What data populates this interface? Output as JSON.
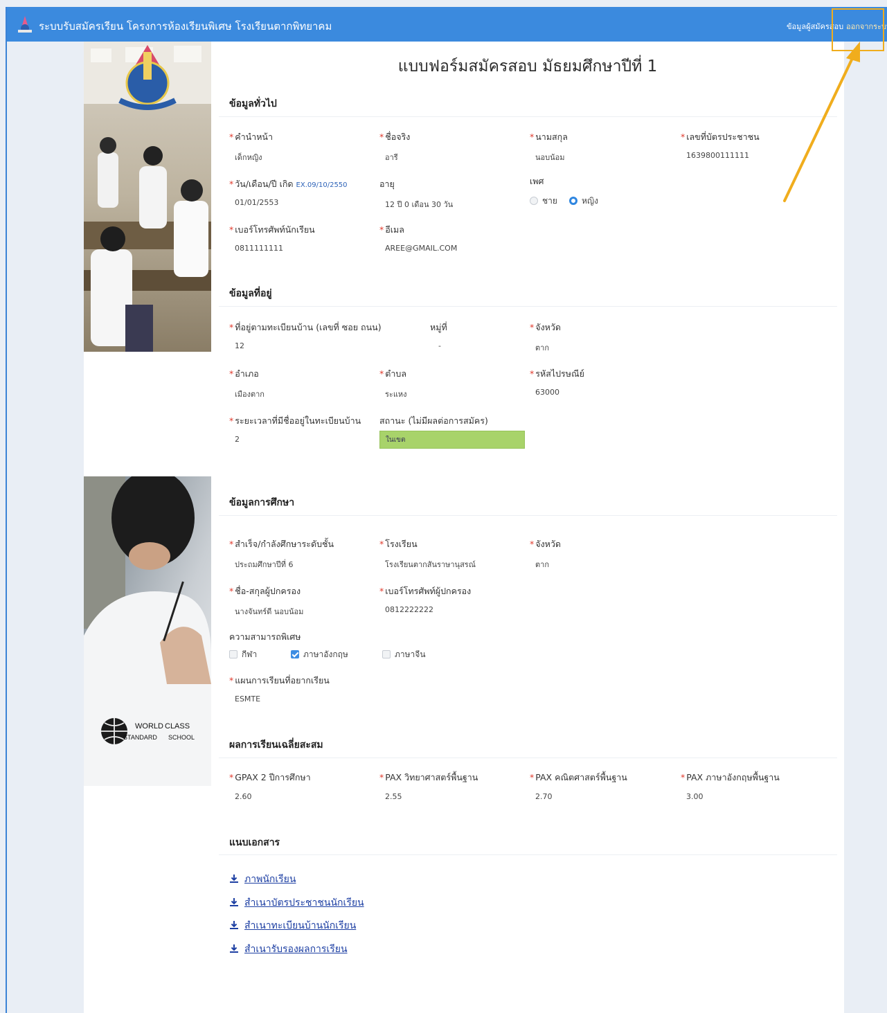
{
  "header": {
    "app_title": "ระบบรับสมัครเรียน โครงการห้องเรียนพิเศษ โรงเรียนตากพิทยาคม",
    "nav_applicant": "ข้อมูลผู้สมัครสอบ",
    "nav_logout": "ออกจากระบบ"
  },
  "form": {
    "title": "แบบฟอร์มสมัครสอบ มัธยมศึกษาปีที่ 1",
    "general": {
      "section": "ข้อมูลทั่วไป",
      "prefix_label": "คำนำหน้า",
      "prefix": "เด็กหญิง",
      "firstname_label": "ชื่อจริง",
      "firstname": "อารี",
      "lastname_label": "นามสกุล",
      "lastname": "นอบน้อม",
      "idcard_label": "เลขที่บัตรประชาชน",
      "idcard": "1639800111111",
      "dob_label": "วัน/เดือน/ปี เกิด",
      "dob_hint": "EX.09/10/2550",
      "dob": "01/01/2553",
      "age_label": "อายุ",
      "age": "12 ปี 0 เดือน 30 วัน",
      "gender_label": "เพศ",
      "gender_male": "ชาย",
      "gender_female": "หญิง",
      "phone_label": "เบอร์โทรศัพท์นักเรียน",
      "phone": "0811111111",
      "email_label": "อีเมล",
      "email": "AREE@GMAIL.COM"
    },
    "address": {
      "section": "ข้อมูลที่อยู่",
      "house_label": "ที่อยู่ตามทะเบียนบ้าน (เลขที่ ซอย ถนน)",
      "house": "12",
      "moo_label": "หมู่ที่",
      "moo": "-",
      "province_label": "จังหวัด",
      "province": "ตาก",
      "district_label": "อำเภอ",
      "district": "เมืองตาก",
      "subdistrict_label": "ตำบล",
      "subdistrict": "ระแหง",
      "postal_label": "รหัสไปรษณีย์",
      "postal": "63000",
      "duration_label": "ระยะเวลาที่มีชื่ออยู่ในทะเบียนบ้าน",
      "duration": "2",
      "status_label": "สถานะ (ไม่มีผลต่อการสมัคร)",
      "status": "ในเขต"
    },
    "education": {
      "section": "ข้อมูลการศึกษา",
      "level_label": "สำเร็จ/กำลังศึกษาระดับชั้น",
      "level": "ประถมศึกษาปีที่ 6",
      "school_label": "โรงเรียน",
      "school": "โรงเรียนตากสันราษานุสรณ์",
      "province_label": "จังหวัด",
      "province": "ตาก",
      "guardian_label": "ชื่อ-สกุลผู้ปกครอง",
      "guardian": "นางจันทร์ดี นอบน้อม",
      "guardian_phone_label": "เบอร์โทรศัพท์ผู้ปกครอง",
      "guardian_phone": "0812222222",
      "talent_label": "ความสามารถพิเศษ",
      "talent_sport": "กีฬา",
      "talent_english": "ภาษาอังกฤษ",
      "talent_chinese": "ภาษาจีน",
      "plan_label": "แผนการเรียนที่อยากเรียน",
      "plan": "ESMTE"
    },
    "grades": {
      "section": "ผลการเรียนเฉลี่ยสะสม",
      "gpax_label": "GPAX 2 ปีการศึกษา",
      "gpax": "2.60",
      "science_label": "PAX วิทยาศาสตร์พื้นฐาน",
      "science": "2.55",
      "math_label": "PAX คณิตศาสตร์พื้นฐาน",
      "math": "2.70",
      "english_label": "PAX ภาษาอังกฤษพื้นฐาน",
      "english": "3.00"
    },
    "documents": {
      "section": "แนบเอกสาร",
      "items": [
        "ภาพนักเรียน",
        "สำเนาบัตรประชาชนนักเรียน",
        "สำเนาทะเบียนบ้านนักเรียน",
        "สำเนารับรองผลการเรียน"
      ]
    }
  },
  "logo_text": {
    "line1": "WORLD",
    "line2": "CLASS",
    "line3": "STANDARD",
    "line4": "SCHOOL"
  },
  "colors": {
    "header": "#3b8ade",
    "highlight": "#f0ad1d",
    "status": "#a8d36a",
    "required": "#e0392b"
  }
}
